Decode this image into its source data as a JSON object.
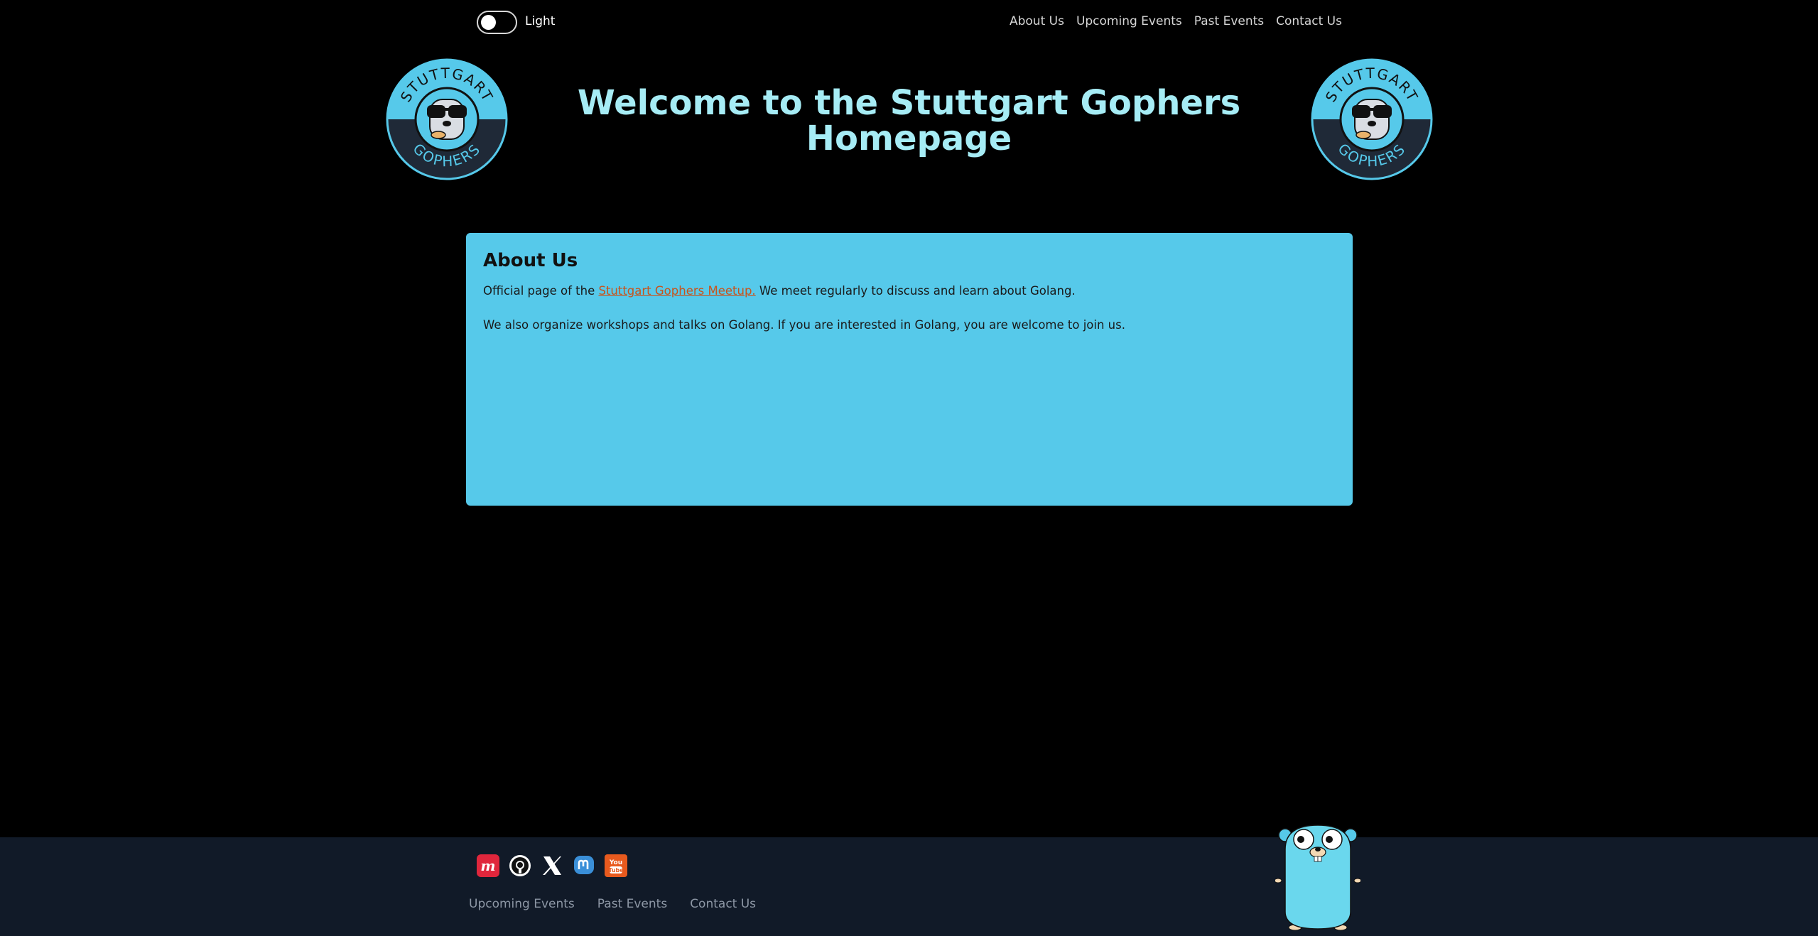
{
  "theme_toggle": {
    "label": "Light"
  },
  "nav": {
    "items": [
      "About Us",
      "Upcoming Events",
      "Past Events",
      "Contact Us"
    ]
  },
  "logo": {
    "top_text": "STUTTGART",
    "bottom_text": "GOPHERS"
  },
  "header": {
    "title": "Welcome to the Stuttgart Gophers Homepage"
  },
  "about": {
    "heading": "About Us",
    "p1_prefix": "Official page of the ",
    "p1_link": "Stuttgart Gophers Meetup.",
    "p1_suffix": " We meet regularly to discuss and learn about Golang.",
    "p2": "We also organize workshops and talks on Golang. If you are interested in Golang, you are welcome to join us."
  },
  "footer": {
    "social_icons": [
      "meetup-icon",
      "github-icon",
      "x-icon",
      "mastodon-icon",
      "youtube-icon"
    ],
    "links": [
      "Upcoming Events",
      "Past Events",
      "Contact Us"
    ]
  },
  "colors": {
    "background": "#000000",
    "accent": "#56c9ea",
    "title": "#a6ecf5",
    "footer": "#111a28",
    "link": "#c8541c"
  }
}
